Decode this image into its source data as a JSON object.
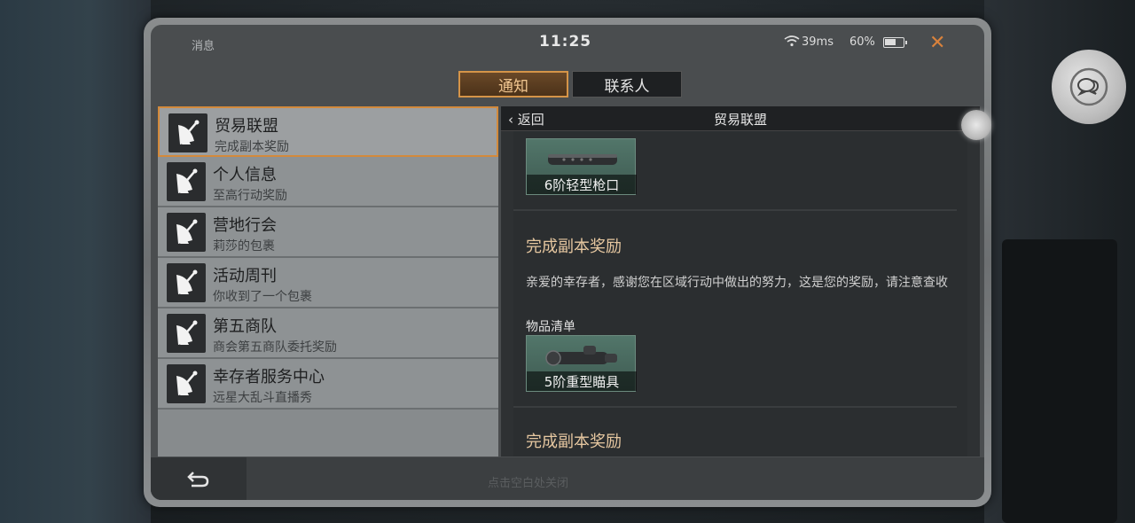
{
  "statusbar": {
    "title": "消息",
    "time": "11:25",
    "ping": "39ms",
    "battery": "60%"
  },
  "tabs": [
    {
      "label": "通知",
      "active": true
    },
    {
      "label": "联系人",
      "active": false
    }
  ],
  "list": [
    {
      "title": "贸易联盟",
      "subtitle": "完成副本奖励"
    },
    {
      "title": "个人信息",
      "subtitle": "至高行动奖励"
    },
    {
      "title": "营地行会",
      "subtitle": "莉莎的包裹"
    },
    {
      "title": "活动周刊",
      "subtitle": "你收到了一个包裹"
    },
    {
      "title": "第五商队",
      "subtitle": "商会第五商队委托奖励"
    },
    {
      "title": "幸存者服务中心",
      "subtitle": "远星大乱斗直播秀"
    }
  ],
  "detail": {
    "back_label": "返回",
    "title": "贸易联盟",
    "item_top": {
      "name": "6阶轻型枪口"
    },
    "message1": {
      "title": "完成副本奖励",
      "body": "亲爱的幸存者，感谢您在区域行动中做出的努力，这是您的奖励，请注意查收",
      "list_label": "物品清单",
      "item": {
        "name": "5阶重型瞄具"
      }
    },
    "message2": {
      "title": "完成副本奖励"
    }
  },
  "bottombar": {
    "hint": "点击空白处关闭"
  },
  "colors": {
    "accent": "#d59448",
    "selected_border": "#d38a3c",
    "item_bg": "#52766a"
  }
}
